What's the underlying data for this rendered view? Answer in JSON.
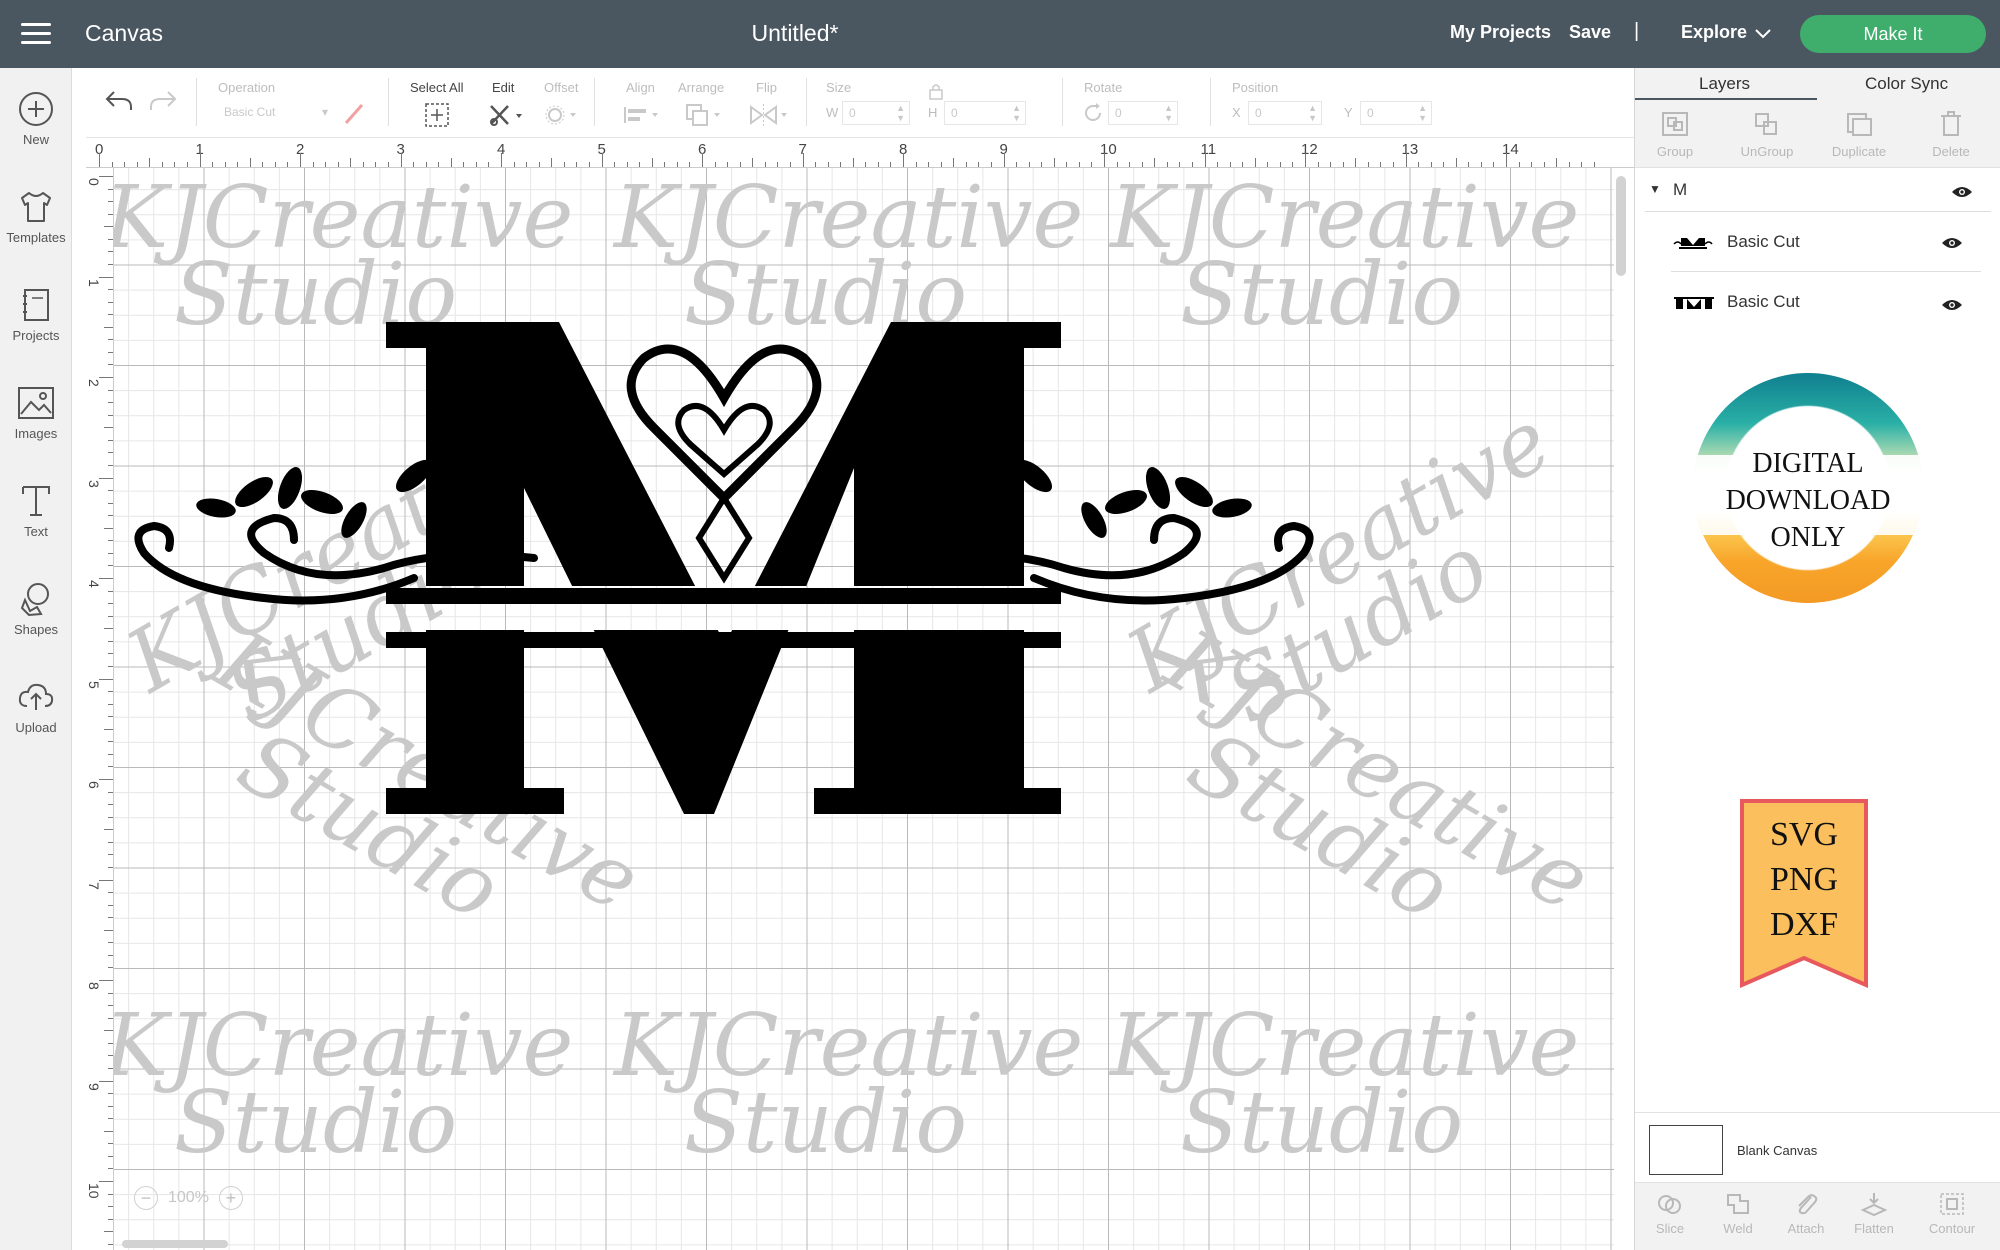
{
  "header": {
    "app_title": "Canvas",
    "doc_title": "Untitled*",
    "my_projects": "My Projects",
    "save": "Save",
    "separator": "|",
    "explore": "Explore",
    "make_it": "Make It"
  },
  "sidebar": {
    "items": [
      {
        "label": "New",
        "icon": "plus-circle-icon"
      },
      {
        "label": "Templates",
        "icon": "tshirt-icon"
      },
      {
        "label": "Projects",
        "icon": "notebook-icon"
      },
      {
        "label": "Images",
        "icon": "image-icon"
      },
      {
        "label": "Text",
        "icon": "text-icon"
      },
      {
        "label": "Shapes",
        "icon": "shapes-icon"
      },
      {
        "label": "Upload",
        "icon": "cloud-upload-icon"
      }
    ]
  },
  "toolbar": {
    "operation_label": "Operation",
    "operation_value": "Basic Cut",
    "select_all": "Select All",
    "edit": "Edit",
    "offset": "Offset",
    "align": "Align",
    "arrange": "Arrange",
    "flip": "Flip",
    "size": "Size",
    "w_label": "W",
    "w_value": "0",
    "h_label": "H",
    "h_value": "0",
    "rotate": "Rotate",
    "rotate_value": "0",
    "position": "Position",
    "x_label": "X",
    "x_value": "0",
    "y_label": "Y",
    "y_value": "0"
  },
  "ruler": {
    "top": [
      "0",
      "1",
      "2",
      "3",
      "4",
      "5",
      "6",
      "7",
      "8",
      "9",
      "10",
      "11",
      "12",
      "13",
      "14"
    ],
    "left": [
      "0",
      "1",
      "2",
      "3",
      "4",
      "5",
      "6",
      "7",
      "8",
      "9",
      "10"
    ]
  },
  "canvas": {
    "watermark_line1": "KJCreative",
    "watermark_line2": "Studio",
    "zoom": "100%",
    "zoom_out": "−",
    "zoom_in": "+"
  },
  "right_panel": {
    "tabs": [
      "Layers",
      "Color Sync"
    ],
    "actions": [
      "Group",
      "UnGroup",
      "Duplicate",
      "Delete"
    ],
    "group_name": "M",
    "layers": [
      {
        "name": "Basic Cut"
      },
      {
        "name": "Basic Cut"
      }
    ],
    "badge_lines": [
      "DIGITAL",
      "DOWNLOAD",
      "ONLY"
    ],
    "ribbon_lines": [
      "SVG",
      "PNG",
      "DXF"
    ],
    "blank_canvas": "Blank Canvas",
    "bottom_actions": [
      "Slice",
      "Weld",
      "Attach",
      "Flatten",
      "Contour"
    ]
  },
  "colors": {
    "header_bg": "#4a5660",
    "make_it_green": "#3fae6d",
    "ribbon_fill": "#fbbf5d",
    "ribbon_border": "#e8595d"
  }
}
